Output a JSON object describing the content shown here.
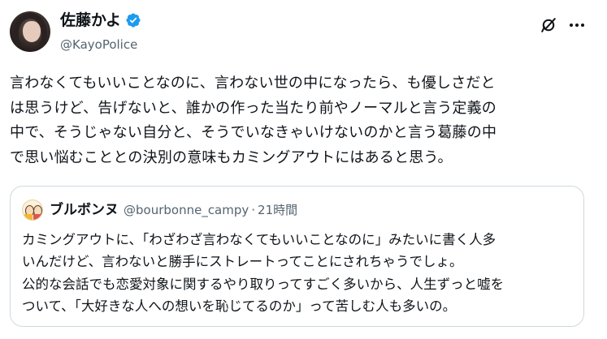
{
  "author": {
    "display_name": "佐藤かよ",
    "handle": "@KayoPolice",
    "verified": true
  },
  "header_icons": [
    "grok-icon",
    "more-icon"
  ],
  "tweet": {
    "lines": [
      "言わなくてもいいことなのに、言わない世の中になったら、も優しさだと",
      "は思うけど、告げないと、誰かの作った当たり前やノーマルと言う定義の",
      "中で、そうじゃない自分と、そうでいなきゃいけないのかと言う葛藤の中",
      "で思い悩むこととの決別の意味もカミングアウトにはあると思う。"
    ]
  },
  "quote": {
    "display_name": "ブルボンヌ",
    "handle": "@bourbonne_campy",
    "separator": "·",
    "time": "21時間",
    "lines": [
      "カミングアウトに、「わざわざ言わなくてもいいことなのに」みたいに書く人多",
      "いんだけど、言わないと勝手にストレートってことにされちゃうでしょ。",
      "公的な会話でも恋愛対象に関するやり取りってすごく多いから、人生ずっと嘘を",
      "ついて、「大好きな人への想いを恥じてるのか」って苦しむ人も多いの。"
    ]
  },
  "colors": {
    "text": "#0f1419",
    "secondary": "#536471",
    "verified": "#1d9bf0",
    "border": "#cfd9de"
  }
}
